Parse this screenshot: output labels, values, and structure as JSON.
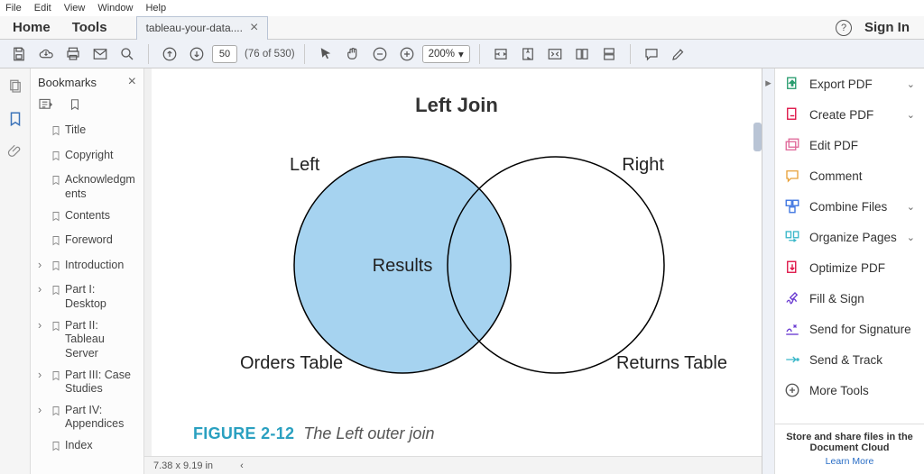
{
  "menubar": {
    "items": [
      "File",
      "Edit",
      "View",
      "Window",
      "Help"
    ]
  },
  "primary_tabs": {
    "home": "Home",
    "tools": "Tools"
  },
  "doc_tab": {
    "title": "tableau-your-data...."
  },
  "signin": "Sign In",
  "toolbar": {
    "page_input": "50",
    "page_count": "(76 of 530)",
    "zoom": "200%"
  },
  "bookmarks": {
    "title": "Bookmarks",
    "items": [
      {
        "label": "Title",
        "expandable": false
      },
      {
        "label": "Copyright",
        "expandable": false
      },
      {
        "label": "Acknowledgments",
        "expandable": false
      },
      {
        "label": "Contents",
        "expandable": false
      },
      {
        "label": "Foreword",
        "expandable": false
      },
      {
        "label": "Introduction",
        "expandable": true
      },
      {
        "label": "Part I: Desktop",
        "expandable": true
      },
      {
        "label": "Part II: Tableau Server",
        "expandable": true
      },
      {
        "label": "Part III: Case Studies",
        "expandable": true
      },
      {
        "label": "Part IV: Appendices",
        "expandable": true
      },
      {
        "label": "Index",
        "expandable": false
      }
    ]
  },
  "figure": {
    "title": "Left Join",
    "left_label": "Left",
    "right_label": "Right",
    "center_label": "Results",
    "left_table": "Orders Table",
    "right_table": "Returns Table",
    "caption_num": "FIGURE 2-12",
    "caption_text": "The Left outer join"
  },
  "status": {
    "dims": "7.38 x 9.19 in"
  },
  "rightpanel": {
    "items": [
      {
        "label": "Export PDF",
        "chevron": true,
        "icon": "export",
        "color": "#2a9d6f"
      },
      {
        "label": "Create PDF",
        "chevron": true,
        "icon": "create",
        "color": "#d14"
      },
      {
        "label": "Edit PDF",
        "chevron": false,
        "icon": "edit",
        "color": "#e06a9a"
      },
      {
        "label": "Comment",
        "chevron": false,
        "icon": "comment",
        "color": "#e8a13a"
      },
      {
        "label": "Combine Files",
        "chevron": true,
        "icon": "combine",
        "color": "#3b73e0"
      },
      {
        "label": "Organize Pages",
        "chevron": true,
        "icon": "organize",
        "color": "#3bb8c9"
      },
      {
        "label": "Optimize PDF",
        "chevron": false,
        "icon": "optimize",
        "color": "#d14"
      },
      {
        "label": "Fill & Sign",
        "chevron": false,
        "icon": "sign",
        "color": "#6a3bd1"
      },
      {
        "label": "Send for Signature",
        "chevron": false,
        "icon": "sendSig",
        "color": "#6a3bd1"
      },
      {
        "label": "Send & Track",
        "chevron": false,
        "icon": "track",
        "color": "#3bb8c9"
      },
      {
        "label": "More Tools",
        "chevron": false,
        "icon": "more",
        "color": "#555"
      }
    ],
    "footer_bold": "Store and share files in the Document Cloud",
    "footer_link": "Learn More"
  }
}
